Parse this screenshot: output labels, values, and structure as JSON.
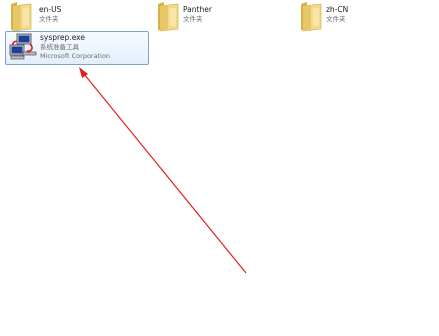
{
  "items": {
    "folder_en": {
      "name": "en-US",
      "type": "文件夹"
    },
    "folder_panther": {
      "name": "Panther",
      "type": "文件夹"
    },
    "folder_zh": {
      "name": "zh-CN",
      "type": "文件夹"
    },
    "sysprep": {
      "name": "sysprep.exe",
      "description": "系统准备工具",
      "company": "Microsoft Corporation",
      "selected": true
    }
  },
  "colors": {
    "folder": "#e8c866",
    "selection_border": "#7da2ce",
    "annotation_arrow": "#e02020"
  },
  "icons": {
    "folder": "folder-icon",
    "sysprep": "sysprep-app-icon"
  }
}
